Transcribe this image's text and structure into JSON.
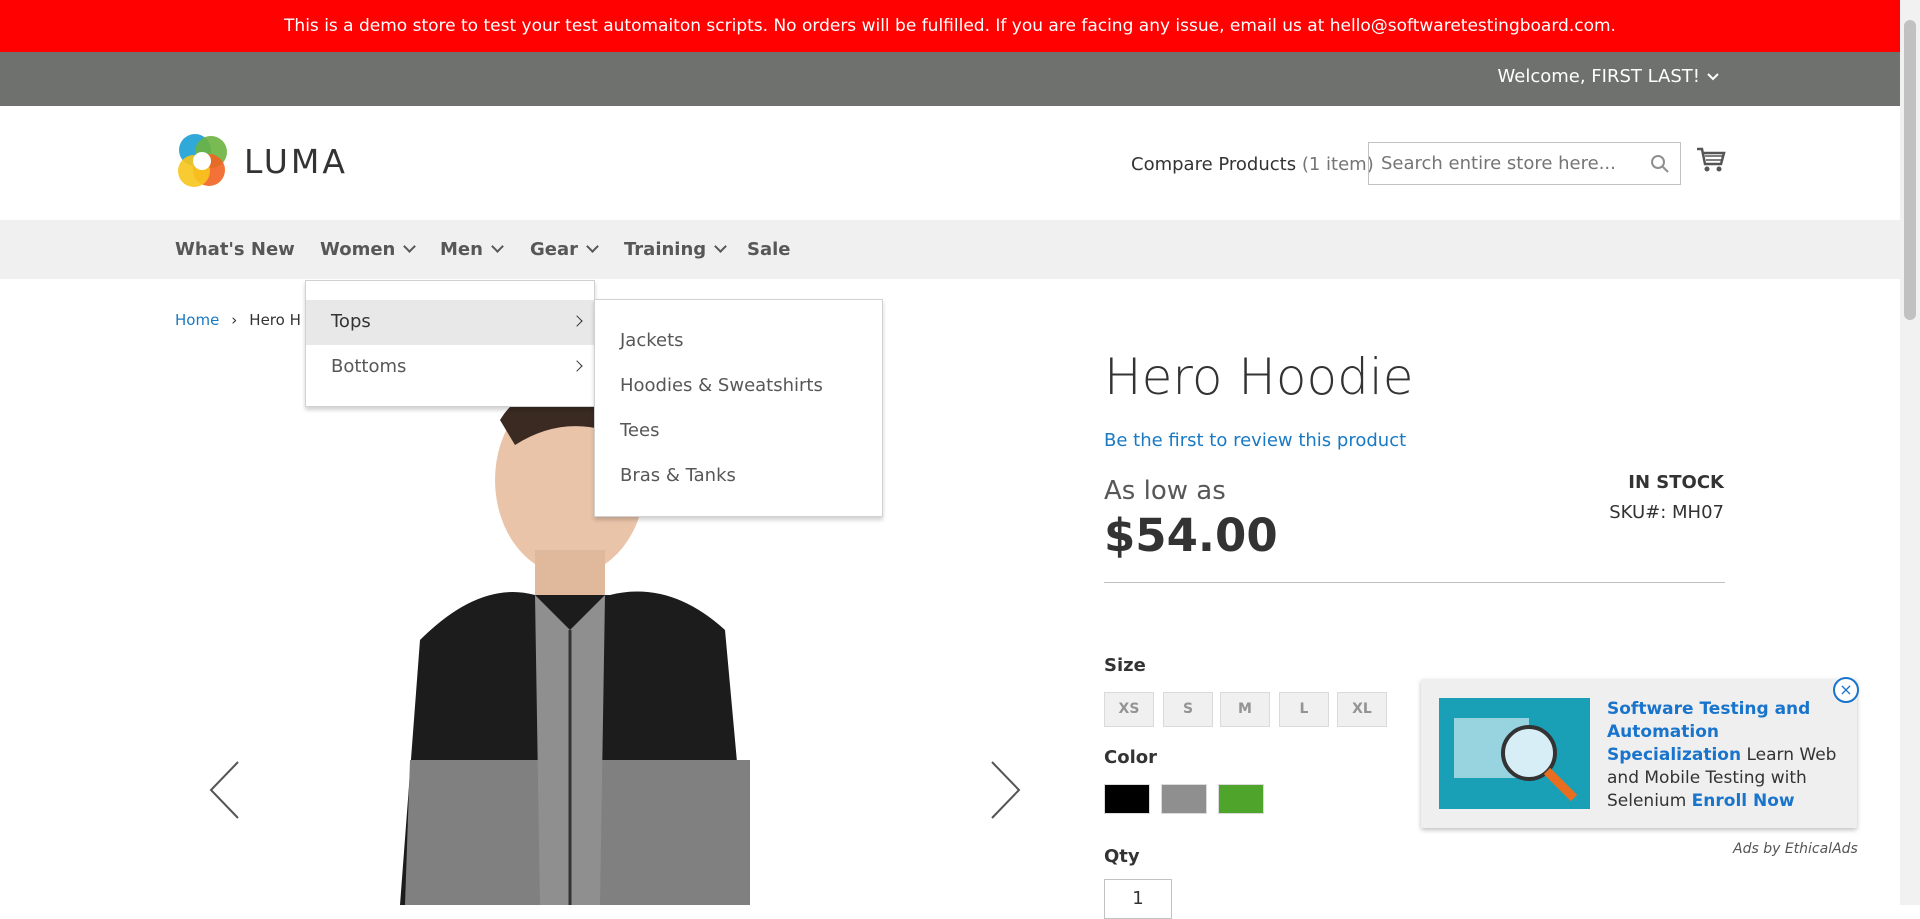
{
  "banner": {
    "text": "This is a demo store to test your test automaiton scripts. No orders will be fulfilled. If you are facing any issue, email us at hello@softwaretestingboard.com."
  },
  "topbar": {
    "welcome": "Welcome, FIRST LAST!"
  },
  "header": {
    "logo_text": "LUMA",
    "compare_label": "Compare Products",
    "compare_count": "(1 item)",
    "search_placeholder": "Search entire store here..."
  },
  "nav": {
    "items": [
      {
        "label": "What's New"
      },
      {
        "label": "Women"
      },
      {
        "label": "Men"
      },
      {
        "label": "Gear"
      },
      {
        "label": "Training"
      },
      {
        "label": "Sale"
      }
    ]
  },
  "dropdown": {
    "level1": [
      {
        "label": "Tops"
      },
      {
        "label": "Bottoms"
      }
    ],
    "level2": [
      {
        "label": "Jackets"
      },
      {
        "label": "Hoodies & Sweatshirts"
      },
      {
        "label": "Tees"
      },
      {
        "label": "Bras & Tanks"
      }
    ]
  },
  "breadcrumb": {
    "home": "Home",
    "current": "Hero H"
  },
  "product": {
    "title": "Hero Hoodie",
    "review_link": "Be the first to review this product",
    "as_low_as": "As low as",
    "price": "$54.00",
    "stock": "IN STOCK",
    "sku": "SKU#:  MH07",
    "size_label": "Size",
    "sizes": [
      "XS",
      "S",
      "M",
      "L",
      "XL"
    ],
    "color_label": "Color",
    "colors": [
      "#000000",
      "#8f8f8f",
      "#4fa52c"
    ],
    "qty_label": "Qty",
    "qty_value": "1"
  },
  "ad": {
    "title": "Software Testing and Automation Specialization",
    "body": "Learn Web and Mobile Testing with Selenium",
    "cta": "Enroll Now",
    "close": "×",
    "attribution": "Ads by EthicalAds"
  }
}
